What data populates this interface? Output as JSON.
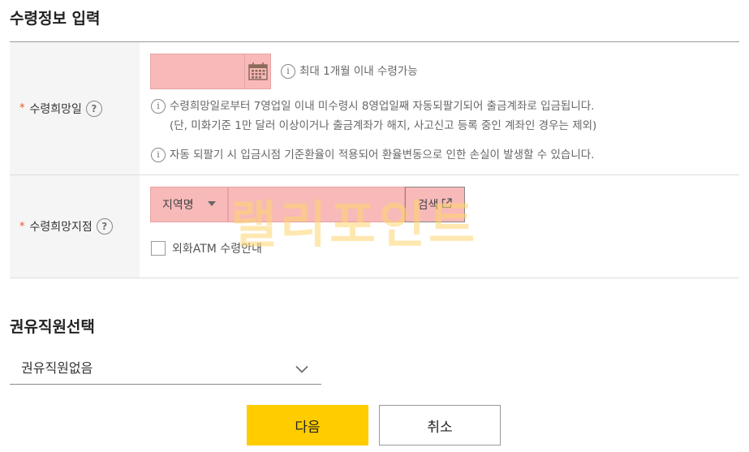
{
  "sections": {
    "receipt_title": "수령정보 입력",
    "staff_title": "권유직원선택"
  },
  "receipt_date": {
    "label": "수령희망일",
    "required_mark": "*",
    "help": "?",
    "value": "",
    "note_limit": "최대 1개월 이내 수령가능",
    "note_business_line1": "수령희망일로부터 7영업일 이내 미수령시 8영업일째 자동되팔기되어 출금계좌로 입금됩니다.",
    "note_business_line2": "(단, 미화기준 1만 달러 이상이거나 출금계좌가 해지, 사고신고 등록 중인 계좌인 경우는 제외)",
    "note_exchange": "자동 되팔기 시 입금시점 기준환율이 적용되어 환율변동으로 인한 손실이 발생할 수 있습니다.",
    "info_glyph": "i"
  },
  "receipt_branch": {
    "label": "수령희망지점",
    "required_mark": "*",
    "help": "?",
    "region_select": "지역명",
    "branch_value": "",
    "search_label": "검색",
    "atm_label": "외화ATM 수령안내",
    "atm_checked": false
  },
  "staff": {
    "selected": "권유직원없음"
  },
  "buttons": {
    "next": "다음",
    "cancel": "취소"
  },
  "watermark": "랠리포인트",
  "colors": {
    "accent_yellow": "#ffcc00",
    "required_star": "#e05b2c",
    "highlight_pink": "#f8b9b9"
  },
  "icons": {
    "calendar": "calendar-icon",
    "help": "question-circle-icon",
    "info": "info-circle-icon",
    "external": "external-link-icon",
    "dropdown": "chevron-down-icon"
  }
}
